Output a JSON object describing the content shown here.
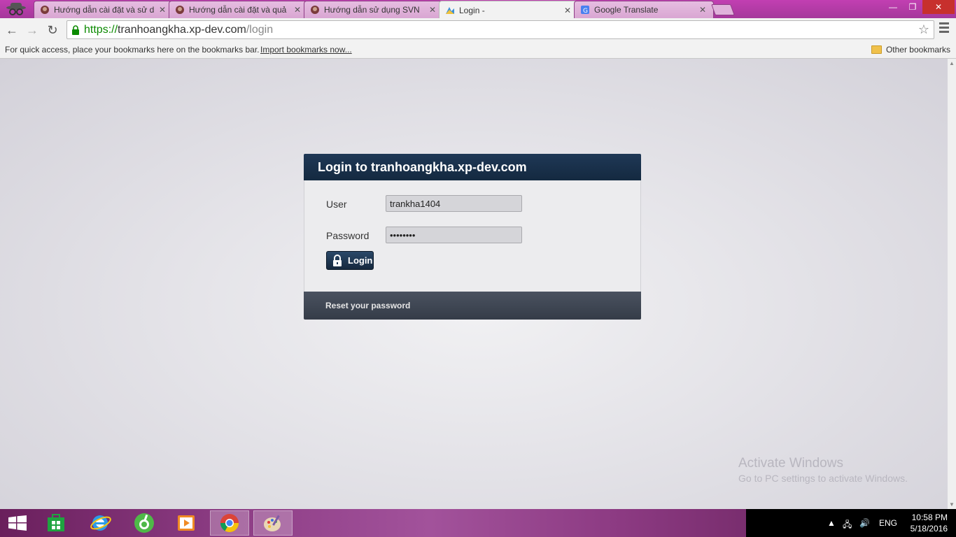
{
  "browser": {
    "tabs": [
      {
        "title": "Hướng dẫn cài đặt và sử d",
        "active": false,
        "favicon": "site-favicon"
      },
      {
        "title": "Hướng dẫn cài đặt và quả",
        "active": false,
        "favicon": "site-favicon"
      },
      {
        "title": "Hướng dẫn sử dụng SVN",
        "active": false,
        "favicon": "site-favicon"
      },
      {
        "title": "Login -",
        "active": true,
        "favicon": "xp-dev-favicon"
      },
      {
        "title": "Google Translate",
        "active": false,
        "favicon": "google-translate-favicon"
      }
    ],
    "url": {
      "scheme": "https://",
      "host": "tranhoangkha.xp-dev.com",
      "path": "/login"
    },
    "bookmarks_hint": "For quick access, place your bookmarks here on the bookmarks bar.",
    "import_link": "Import bookmarks now...",
    "other_bookmarks": "Other bookmarks",
    "accent_color": "#b53ca7"
  },
  "login": {
    "header": "Login to tranhoangkha.xp-dev.com",
    "user_label": "User",
    "user_value": "trankha1404",
    "password_label": "Password",
    "password_value": "••••••••",
    "login_button": "Login",
    "reset_link": "Reset your password"
  },
  "watermark": {
    "line1": "Activate Windows",
    "line2": "Go to PC settings to activate Windows."
  },
  "taskbar": {
    "apps": [
      "store-icon",
      "internet-explorer-icon",
      "coc-coc-icon",
      "media-player-icon",
      "chrome-icon",
      "paint-icon"
    ],
    "language": "ENG",
    "time": "10:58 PM",
    "date": "5/18/2016"
  }
}
